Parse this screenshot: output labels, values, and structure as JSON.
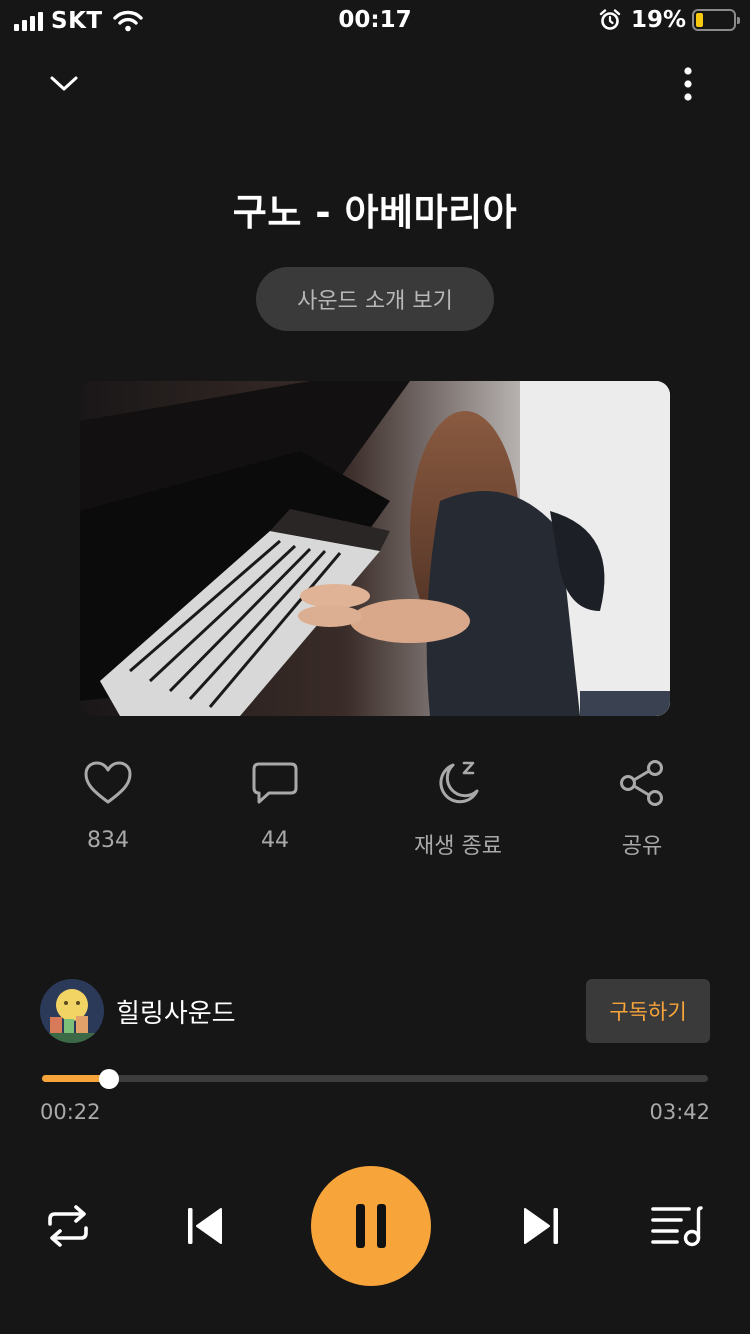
{
  "status_bar": {
    "carrier": "SKT",
    "time": "00:17",
    "battery_percent": "19%",
    "battery_level": 0.19,
    "battery_color": "#f6c90e"
  },
  "nav": {
    "collapse_icon": "chevron-down-icon",
    "more_icon": "more-vertical-icon"
  },
  "track": {
    "title": "구노 - 아베마리아",
    "intro_button": "사운드 소개 보기",
    "artwork": "girl-playing-piano-photo"
  },
  "actions": {
    "like": {
      "icon": "heart-icon",
      "label": "834"
    },
    "comment": {
      "icon": "comment-icon",
      "label": "44"
    },
    "sleep": {
      "icon": "moon-sleep-icon",
      "label": "재생 종료"
    },
    "share": {
      "icon": "share-icon",
      "label": "공유"
    }
  },
  "channel": {
    "name": "힐링사운드",
    "subscribe_label": "구독하기"
  },
  "player": {
    "elapsed": "00:22",
    "total": "03:42",
    "progress": 0.1,
    "accent_color": "#f7a43b",
    "icons": [
      "repeat-icon",
      "skip-previous-icon",
      "pause-icon",
      "skip-next-icon",
      "playlist-icon"
    ]
  }
}
